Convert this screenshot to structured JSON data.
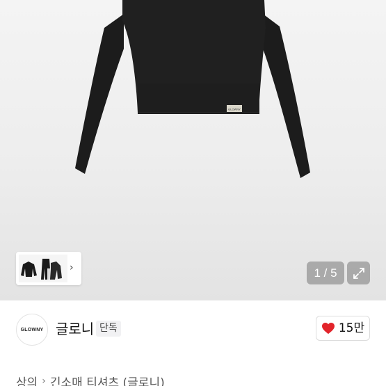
{
  "gallery": {
    "current_page": "1 / 5",
    "thumbnail_chevron": "›",
    "product_label_text": "GLOWNY"
  },
  "brand": {
    "logo_text": "GLOWNY",
    "name": "글로니",
    "badge": "단독"
  },
  "like": {
    "icon": "heart-icon",
    "count": "15만",
    "color": "#e2242b"
  },
  "breadcrumb": {
    "items": [
      "상의",
      "긴소매 티셔츠 (글로니)"
    ],
    "separator": "›"
  }
}
